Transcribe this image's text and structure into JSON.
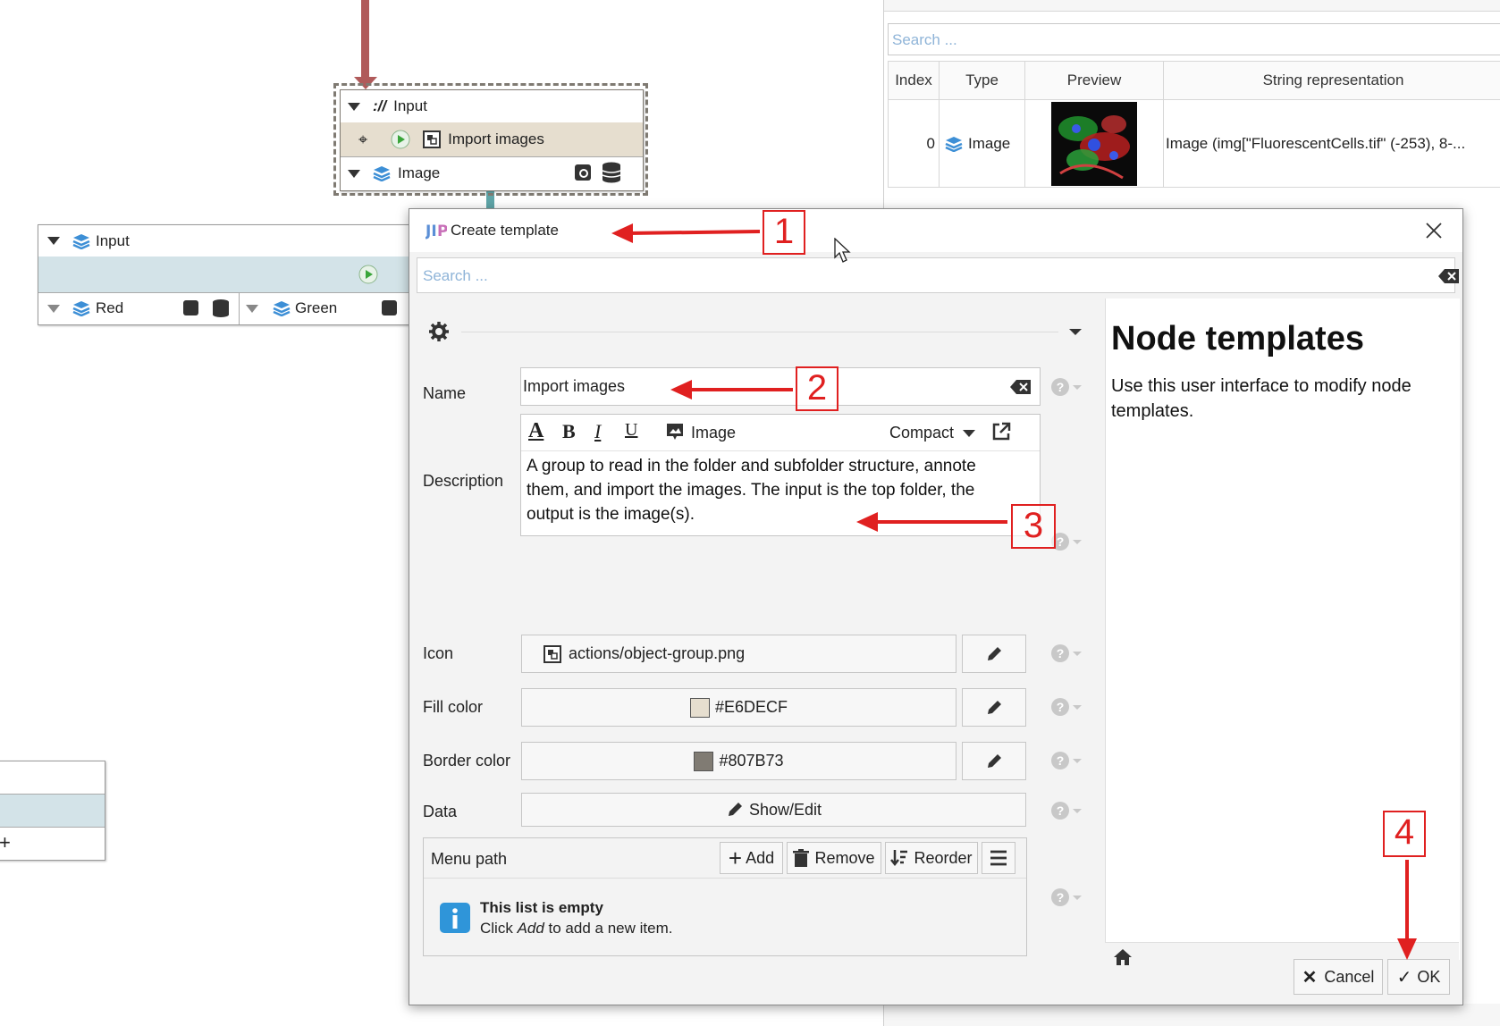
{
  "graph": {
    "group_node": {
      "input_slot": "Input",
      "input_prefix": "://",
      "title": "Import images",
      "output_slot": "Image",
      "fill_color": "#E6DECF",
      "border_color": "#807B73"
    },
    "merge_node": {
      "input_slot": "Input",
      "outputs": [
        "Red",
        "Green"
      ]
    }
  },
  "cache_table": {
    "search_placeholder": "Search ...",
    "columns": [
      "Index",
      "Type",
      "Preview",
      "String representation"
    ],
    "rows": [
      {
        "index": "0",
        "type": "Image",
        "string": "Image (img[\"FluorescentCells.tif\" (-253), 8-..."
      }
    ]
  },
  "dialog": {
    "title": "Create template",
    "search_placeholder": "Search ...",
    "fields": {
      "name_label": "Name",
      "name_value": "Import images",
      "description_label": "Description",
      "description_value": "A group to read in the folder and subfolder structure, annote them, and import the images. The input is the top folder, the output is the image(s).",
      "icon_label": "Icon",
      "icon_value": "actions/object-group.png",
      "fill_label": "Fill color",
      "fill_value": "#E6DECF",
      "border_label": "Border color",
      "border_value": "#807B73",
      "data_label": "Data",
      "data_button": "Show/Edit"
    },
    "editor_toolbar": {
      "image_label": "Image",
      "mode_label": "Compact"
    },
    "menu_path": {
      "label": "Menu path",
      "add": "Add",
      "remove": "Remove",
      "reorder": "Reorder",
      "empty_title": "This list is empty",
      "empty_hint_prefix": "Click ",
      "empty_hint_em": "Add",
      "empty_hint_suffix": " to add a new item."
    },
    "help": {
      "title": "Node templates",
      "body": "Use this user interface to modify node templates."
    },
    "buttons": {
      "cancel": "Cancel",
      "ok": "OK"
    }
  },
  "annotations": [
    "1",
    "2",
    "3",
    "4"
  ],
  "colors": {
    "accent_red": "#e02020",
    "link_blue": "#4a8fd1",
    "slot_bg": "#d3e3e8"
  }
}
